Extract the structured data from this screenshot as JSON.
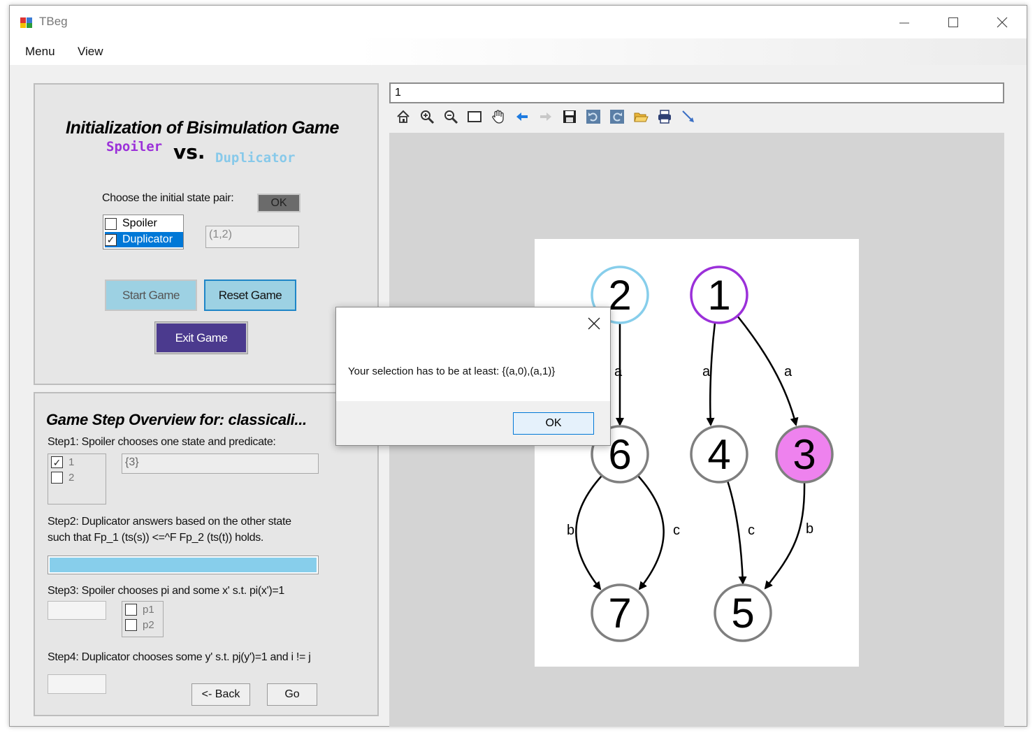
{
  "window": {
    "title": "TBeg"
  },
  "menu": [
    "Menu",
    "View"
  ],
  "init_panel": {
    "title": "Initialization of Bisimulation Game",
    "spoiler": "Spoiler",
    "vs": "vs.",
    "duplicator": "Duplicator",
    "choose_label": "Choose the initial state pair:",
    "ok_label": "OK",
    "players": [
      {
        "label": "Spoiler",
        "checked": false
      },
      {
        "label": "Duplicator",
        "checked": true
      }
    ],
    "state_pair_value": "(1,2)",
    "start_label": "Start Game",
    "reset_label": "Reset Game",
    "exit_label": "Exit Game"
  },
  "overview": {
    "title": "Game Step Overview for: classicali...",
    "step1": "Step1: Spoiler chooses one state and predicate:",
    "step1_states": [
      {
        "label": "1",
        "checked": true
      },
      {
        "label": "2",
        "checked": false
      }
    ],
    "step1_predicate": "{3}",
    "step2_line1": "Step2: Duplicator answers based on the other state",
    "step2_line2": "such that Fp_1 (ts(s)) <=^F Fp_2 (ts(t))  holds.",
    "step3": "Step3: Spoiler chooses pi and some x' s.t. pi(x')=1",
    "step3_options": [
      {
        "label": "p1",
        "checked": false
      },
      {
        "label": "p2",
        "checked": false
      }
    ],
    "step4": "Step4: Duplicator chooses some y' s.t. pj(y')=1 and i != j",
    "back_label": "<- Back",
    "go_label": "Go"
  },
  "viewer": {
    "address_value": "1",
    "toolbar_icons": [
      "home-icon",
      "zoom-in-icon",
      "zoom-out-icon",
      "rectangle-select-icon",
      "pan-hand-icon",
      "back-arrow-icon",
      "forward-arrow-icon",
      "save-icon",
      "undo-icon",
      "redo-icon",
      "open-folder-icon",
      "print-icon",
      "edge-tool-icon"
    ]
  },
  "graph": {
    "nodes": [
      {
        "id": "2",
        "label": "2",
        "stroke": "#87ceeb",
        "fill": "#ffffff"
      },
      {
        "id": "1",
        "label": "1",
        "stroke": "#9b30d9",
        "fill": "#ffffff"
      },
      {
        "id": "6",
        "label": "6",
        "stroke": "#7f7f7f",
        "fill": "#ffffff"
      },
      {
        "id": "4",
        "label": "4",
        "stroke": "#7f7f7f",
        "fill": "#ffffff"
      },
      {
        "id": "3",
        "label": "3",
        "stroke": "#7f7f7f",
        "fill": "#ee82ee"
      },
      {
        "id": "7",
        "label": "7",
        "stroke": "#7f7f7f",
        "fill": "#ffffff"
      },
      {
        "id": "5",
        "label": "5",
        "stroke": "#7f7f7f",
        "fill": "#ffffff"
      }
    ],
    "edges": [
      {
        "from": "2",
        "to": "6",
        "label": "a"
      },
      {
        "from": "1",
        "to": "4",
        "label": "a"
      },
      {
        "from": "1",
        "to": "3",
        "label": "a"
      },
      {
        "from": "6",
        "to": "7",
        "label": "b"
      },
      {
        "from": "6",
        "to": "7",
        "label": "c"
      },
      {
        "from": "4",
        "to": "5",
        "label": "c"
      },
      {
        "from": "3",
        "to": "5",
        "label": "b"
      }
    ]
  },
  "dialog": {
    "message": "Your selection has to be at least: {(a,0),(a,1)}",
    "ok_label": "OK"
  },
  "colors": {
    "spoiler": "#9b30d9",
    "duplicator": "#87ceeb",
    "exit_button": "#4b3a8e",
    "progress_fill": "#87ceeb"
  }
}
